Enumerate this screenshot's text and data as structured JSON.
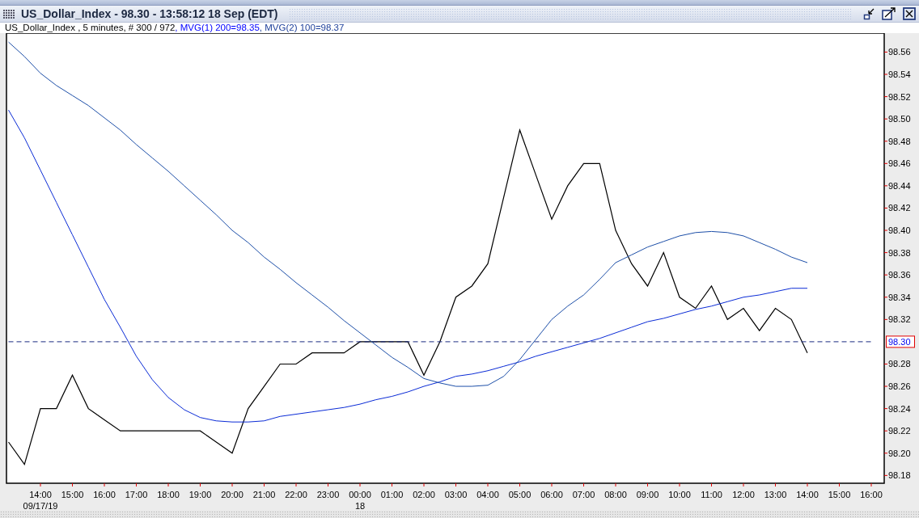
{
  "window": {
    "title": "US_Dollar_Index - 98.30 - 13:58:12  18 Sep (EDT)"
  },
  "legend": [
    {
      "text": "US_Dollar_Index , 5 minutes, # 300 / 972",
      "color": "#000000"
    },
    {
      "text": ", MVG(1) 200=98.35",
      "color": "#0000ff"
    },
    {
      "text": ", MVG(2) 100=98.37",
      "color": "#1d3f9a"
    }
  ],
  "last_price_label": "98.30",
  "date_labels": [
    {
      "text": "09/17/19"
    },
    {
      "text": "18"
    }
  ],
  "chart_data": {
    "type": "line",
    "categories": [
      null,
      null,
      "14:00",
      null,
      "15:00",
      null,
      "16:00",
      null,
      "17:00",
      null,
      "18:00",
      null,
      "19:00",
      null,
      "20:00",
      null,
      "21:00",
      null,
      "22:00",
      null,
      "23:00",
      null,
      "00:00",
      null,
      "01:00",
      null,
      "02:00",
      null,
      "03:00",
      null,
      "04:00",
      null,
      "05:00",
      null,
      "06:00",
      null,
      "07:00",
      null,
      "08:00",
      null,
      "09:00",
      null,
      "10:00",
      null,
      "11:00",
      null,
      "12:00",
      null,
      "13:00",
      null,
      "14:00",
      null,
      "15:00",
      null,
      "16:00"
    ],
    "series": [
      {
        "color": "#000000",
        "values": [
          98.21,
          98.19,
          98.24,
          98.24,
          98.27,
          98.24,
          98.23,
          98.22,
          98.22,
          98.22,
          98.22,
          98.22,
          98.22,
          98.21,
          98.2,
          98.24,
          98.26,
          98.28,
          98.28,
          98.29,
          98.29,
          98.29,
          98.3,
          98.3,
          98.3,
          98.3,
          98.27,
          98.3,
          98.34,
          98.35,
          98.37,
          98.43,
          98.49,
          98.45,
          98.41,
          98.44,
          98.46,
          98.46,
          98.4,
          98.37,
          98.35,
          98.38,
          98.34,
          98.33,
          98.35,
          98.32,
          98.33,
          98.31,
          98.33,
          98.32,
          98.29,
          null,
          null,
          null,
          null
        ]
      },
      {
        "color": "#0a2bd6",
        "values": [
          98.508,
          98.483,
          98.454,
          98.425,
          98.396,
          98.367,
          98.338,
          98.313,
          98.287,
          98.266,
          98.25,
          98.239,
          98.232,
          98.229,
          98.228,
          98.228,
          98.229,
          98.233,
          98.235,
          98.237,
          98.239,
          98.241,
          98.244,
          98.248,
          98.251,
          98.255,
          98.26,
          98.264,
          98.269,
          98.271,
          98.274,
          98.278,
          98.282,
          98.287,
          98.291,
          98.295,
          98.299,
          98.303,
          98.308,
          98.313,
          98.318,
          98.321,
          98.325,
          98.329,
          98.332,
          98.336,
          98.34,
          98.342,
          98.345,
          98.348,
          98.348,
          null,
          null,
          null,
          null
        ]
      },
      {
        "color": "#1a2a80",
        "line_style": "dashed",
        "values": [
          98.3,
          98.3,
          98.3,
          98.3,
          98.3,
          98.3,
          98.3,
          98.3,
          98.3,
          98.3,
          98.3,
          98.3,
          98.3,
          98.3,
          98.3,
          98.3,
          98.3,
          98.3,
          98.3,
          98.3,
          98.3,
          98.3,
          98.3,
          98.3,
          98.3,
          98.3,
          98.3,
          98.3,
          98.3,
          98.3,
          98.3,
          98.3,
          98.3,
          98.3,
          98.3,
          98.3,
          98.3,
          98.3,
          98.3,
          98.3,
          98.3,
          98.3,
          98.3,
          98.3,
          98.3,
          98.3,
          98.3,
          98.3,
          98.3,
          98.3,
          98.3,
          98.3,
          98.3,
          98.3,
          98.3
        ]
      },
      {
        "color": "#1d4fa8",
        "values": [
          98.569,
          98.556,
          98.541,
          98.53,
          98.521,
          98.512,
          98.501,
          98.49,
          98.477,
          98.465,
          98.453,
          98.44,
          98.427,
          98.414,
          98.4,
          98.389,
          98.376,
          98.365,
          98.353,
          98.342,
          98.331,
          98.319,
          98.308,
          98.297,
          98.286,
          98.277,
          98.267,
          98.263,
          98.26,
          98.26,
          98.261,
          98.269,
          98.284,
          98.302,
          98.32,
          98.332,
          98.342,
          98.356,
          98.371,
          98.378,
          98.385,
          98.39,
          98.395,
          98.398,
          98.399,
          98.398,
          98.395,
          98.389,
          98.383,
          98.376,
          98.371,
          null,
          null,
          null,
          null
        ]
      }
    ],
    "ylim": [
      98.173,
      98.577
    ],
    "yticks": [
      {
        "value": 98.56,
        "label": "98.56"
      },
      {
        "value": 98.54,
        "label": "98.54"
      },
      {
        "value": 98.52,
        "label": "98.52"
      },
      {
        "value": 98.5,
        "label": "98.50"
      },
      {
        "value": 98.48,
        "label": "98.48"
      },
      {
        "value": 98.46,
        "label": "98.46"
      },
      {
        "value": 98.44,
        "label": "98.44"
      },
      {
        "value": 98.42,
        "label": "98.42"
      },
      {
        "value": 98.4,
        "label": "98.40"
      },
      {
        "value": 98.38,
        "label": "98.38"
      },
      {
        "value": 98.36,
        "label": "98.36"
      },
      {
        "value": 98.34,
        "label": "98.34"
      },
      {
        "value": 98.32,
        "label": "98.32"
      },
      {
        "value": 98.28,
        "label": "98.28"
      },
      {
        "value": 98.26,
        "label": "98.26"
      },
      {
        "value": 98.24,
        "label": "98.24"
      },
      {
        "value": 98.22,
        "label": "98.22"
      },
      {
        "value": 98.2,
        "label": "98.20"
      },
      {
        "value": 98.18,
        "label": "98.18"
      }
    ]
  }
}
